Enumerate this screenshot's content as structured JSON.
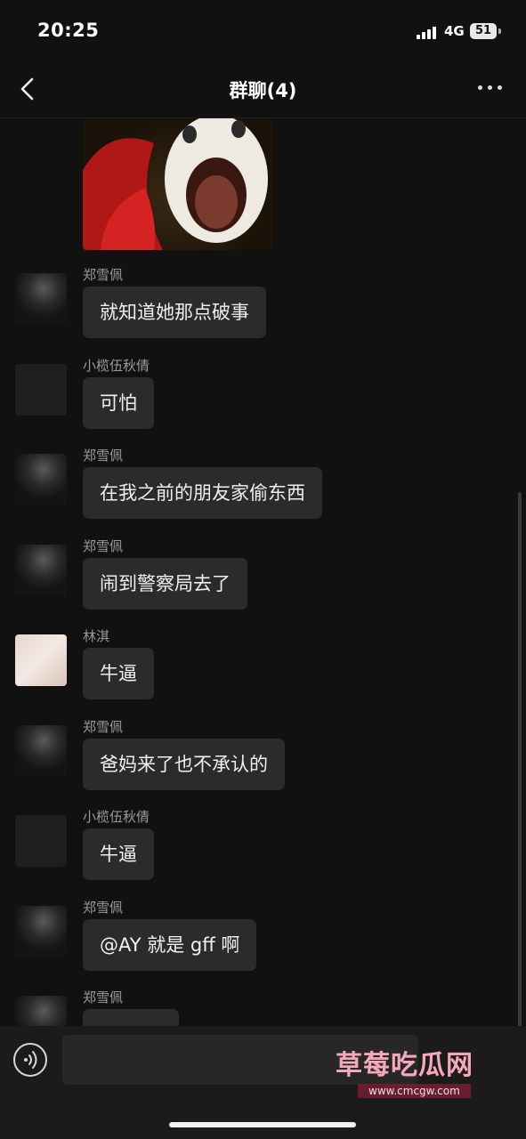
{
  "status_bar": {
    "time": "20:25",
    "network": "4G",
    "battery": "51"
  },
  "header": {
    "title": "群聊(4)"
  },
  "messages": [
    {
      "sender": "郑雪佩",
      "text": "就知道她那点破事"
    },
    {
      "sender": "小榄伍秋倩",
      "text": "可怕"
    },
    {
      "sender": "郑雪佩",
      "text": "在我之前的朋友家偷东西"
    },
    {
      "sender": "郑雪佩",
      "text": "闹到警察局去了"
    },
    {
      "sender": "林淇",
      "text": "牛逼"
    },
    {
      "sender": "郑雪佩",
      "text": "爸妈来了也不承认的"
    },
    {
      "sender": "小榄伍秋倩",
      "text": "牛逼"
    },
    {
      "sender": "郑雪佩",
      "text": "@AY 就是 gff 啊"
    },
    {
      "sender": "郑雪佩",
      "text": ""
    }
  ],
  "watermark": {
    "title": "草莓吃瓜网",
    "url": "www.cmcgw.com"
  },
  "colors": {
    "background": "#111111",
    "bubble": "#2b2b2b",
    "sender": "#9a9a9a"
  },
  "icons": {
    "back": "chevron-left-icon",
    "more": "more-dots-icon",
    "voice": "voice-icon"
  }
}
